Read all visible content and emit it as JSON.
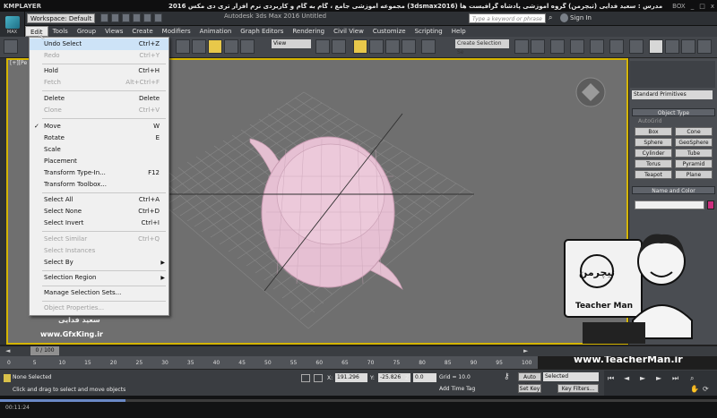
{
  "player": {
    "logo": "KMPLAYER",
    "title": "مجموعه آموزشی جامع ، گام به گام و کاربردی نرم افزار تری دی مکس 2016 (3dsmax2016) مدرس : سعید فدایی (تیچرمن) گروه آموزشی پادشاه گرافیست ها",
    "controls": [
      "BOX",
      "_",
      "□",
      "x"
    ],
    "time": "00:11:24"
  },
  "app": {
    "logo_label": "MAX",
    "workspace": "Workspace: Default",
    "name": "Autodesk 3ds Max 2016    Untitled",
    "search_placeholder": "Type a keyword or phrase",
    "signin": "Sign In"
  },
  "menubar": [
    "Edit",
    "Tools",
    "Group",
    "Views",
    "Create",
    "Modifiers",
    "Animation",
    "Graph Editors",
    "Rendering",
    "Civil View",
    "Customize",
    "Scripting",
    "Help"
  ],
  "toolbar": {
    "view_select": "View",
    "selection_set": "Create Selection Se"
  },
  "viewport": {
    "label": "[+][Pe"
  },
  "edit_menu": {
    "items": [
      {
        "label": "Undo Select",
        "shortcut": "Ctrl+Z"
      },
      {
        "label": "Redo",
        "shortcut": "Ctrl+Y"
      },
      {
        "label": "Hold",
        "shortcut": "Ctrl+H"
      },
      {
        "label": "Fetch",
        "shortcut": "Alt+Ctrl+F"
      },
      {
        "label": "Delete",
        "shortcut": "Delete"
      },
      {
        "label": "Clone",
        "shortcut": "Ctrl+V"
      },
      {
        "label": "Move",
        "shortcut": "W"
      },
      {
        "label": "Rotate",
        "shortcut": "E"
      },
      {
        "label": "Scale",
        "shortcut": ""
      },
      {
        "label": "Placement",
        "shortcut": ""
      },
      {
        "label": "Transform Type-In...",
        "shortcut": "F12"
      },
      {
        "label": "Transform Toolbox...",
        "shortcut": ""
      },
      {
        "label": "Select All",
        "shortcut": "Ctrl+A"
      },
      {
        "label": "Select None",
        "shortcut": "Ctrl+D"
      },
      {
        "label": "Select Invert",
        "shortcut": "Ctrl+I"
      },
      {
        "label": "Select Similar",
        "shortcut": "Ctrl+Q"
      },
      {
        "label": "Select Instances",
        "shortcut": ""
      },
      {
        "label": "Select By",
        "shortcut": ""
      },
      {
        "label": "Selection Region",
        "shortcut": ""
      },
      {
        "label": "Manage Selection Sets...",
        "shortcut": ""
      },
      {
        "label": "Object Properties...",
        "shortcut": ""
      }
    ]
  },
  "command_panel": {
    "dropdown": "Standard Primitives",
    "object_type_header": "Object Type",
    "autogrid": "AutoGrid",
    "buttons": [
      "Box",
      "Cone",
      "Sphere",
      "GeoSphere",
      "Cylinder",
      "Tube",
      "Torus",
      "Pyramid",
      "Teapot",
      "Plane"
    ],
    "name_color_header": "Name and Color",
    "swatch_color": "#cc2f7e"
  },
  "overlay": {
    "watermark_name": "سعید فدایی",
    "watermark_site": "www.GfxKing.ir",
    "teacher_url": "www.TeacherMan.ir",
    "teacher_logo_text": "تیچرمن",
    "teacher_sub": "Teacher Man"
  },
  "timeline": {
    "position": "0 / 100",
    "ticks": [
      "0",
      "5",
      "10",
      "15",
      "20",
      "25",
      "30",
      "35",
      "40",
      "45",
      "50",
      "55",
      "60",
      "65",
      "70",
      "75",
      "80",
      "85",
      "90",
      "95",
      "100"
    ]
  },
  "status": {
    "selection": "None Selected",
    "prompt": "Click and drag to select and move objects",
    "x_label": "X:",
    "x_value": "191.296",
    "y_label": "Y:",
    "y_value": "-25.826",
    "z_label": "Z:",
    "z_value": "0.0",
    "grid": "Grid = 10.0",
    "add_time_tag": "Add Time Tag",
    "auto_key": "Auto Key",
    "set_key": "Set Key",
    "selected": "Selected",
    "key_filters": "Key Filters..."
  }
}
